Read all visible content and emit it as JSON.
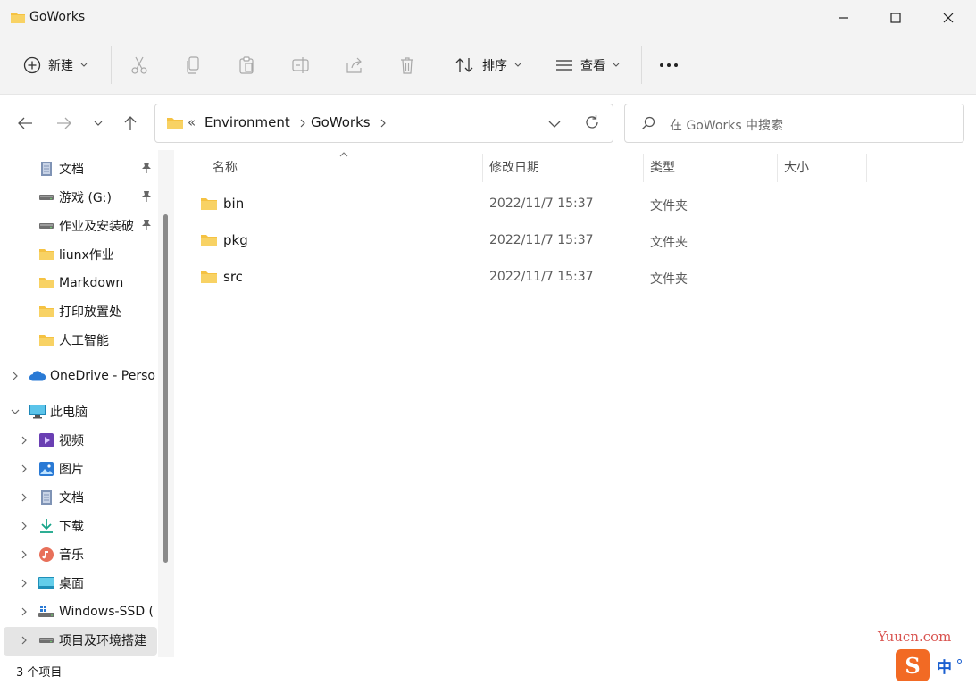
{
  "window": {
    "title": "GoWorks"
  },
  "toolbar": {
    "new_label": "新建",
    "sort_label": "排序",
    "view_label": "查看"
  },
  "address": {
    "segments": [
      "Environment",
      "GoWorks"
    ]
  },
  "search": {
    "placeholder": "在 GoWorks 中搜索"
  },
  "sidebar": {
    "quick_access": [
      {
        "label": "文档",
        "icon": "document-icon",
        "pinned": true
      },
      {
        "label": "游戏 (G:)",
        "icon": "drive-icon",
        "pinned": true
      },
      {
        "label": "作业及安装破",
        "icon": "drive-icon",
        "pinned": true
      },
      {
        "label": "liunx作业",
        "icon": "folder-icon"
      },
      {
        "label": "Markdown",
        "icon": "folder-icon"
      },
      {
        "label": "打印放置处",
        "icon": "folder-icon"
      },
      {
        "label": "人工智能",
        "icon": "folder-icon"
      }
    ],
    "onedrive": "OneDrive - Perso",
    "this_pc": "此电脑",
    "pc_items": [
      {
        "label": "视频",
        "icon": "video-icon"
      },
      {
        "label": "图片",
        "icon": "pictures-icon"
      },
      {
        "label": "文档",
        "icon": "document-icon"
      },
      {
        "label": "下载",
        "icon": "download-icon"
      },
      {
        "label": "音乐",
        "icon": "music-icon"
      },
      {
        "label": "桌面",
        "icon": "desktop-icon"
      },
      {
        "label": "Windows-SSD (",
        "icon": "windows-drive-icon"
      },
      {
        "label": "项目及环境搭建",
        "icon": "drive-icon"
      }
    ]
  },
  "columns": {
    "name": "名称",
    "date": "修改日期",
    "type": "类型",
    "size": "大小"
  },
  "files": [
    {
      "name": "bin",
      "date": "2022/11/7 15:37",
      "type": "文件夹"
    },
    {
      "name": "pkg",
      "date": "2022/11/7 15:37",
      "type": "文件夹"
    },
    {
      "name": "src",
      "date": "2022/11/7 15:37",
      "type": "文件夹"
    }
  ],
  "status": {
    "count": "3 个项目"
  },
  "watermark": "Yuucn.com",
  "ime": {
    "logo": "S",
    "lang": "中"
  },
  "colors": {
    "folder": "#f5c242",
    "onedrive": "#2a7ad5",
    "accent_ime": "#f26a24"
  }
}
